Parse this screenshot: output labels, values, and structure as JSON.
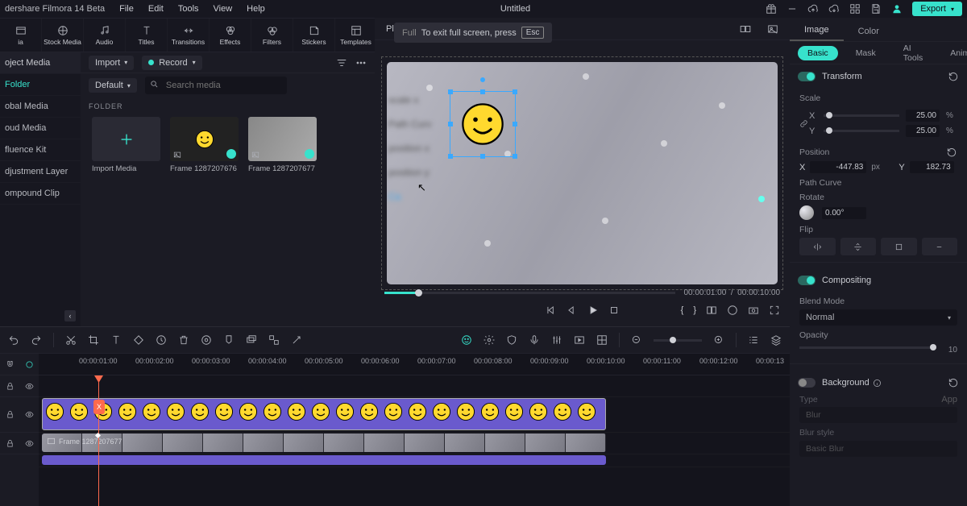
{
  "app_name": "dershare Filmora 14 Beta",
  "menus": [
    "File",
    "Edit",
    "Tools",
    "View",
    "Help"
  ],
  "doc_title": "Untitled",
  "export_label": "Export",
  "ribbon": [
    {
      "id": "media",
      "label": "ia"
    },
    {
      "id": "stock",
      "label": "Stock Media"
    },
    {
      "id": "audio",
      "label": "Audio"
    },
    {
      "id": "titles",
      "label": "Titles"
    },
    {
      "id": "trans",
      "label": "Transitions"
    },
    {
      "id": "effects",
      "label": "Effects"
    },
    {
      "id": "filters",
      "label": "Filters"
    },
    {
      "id": "stickers",
      "label": "Stickers"
    },
    {
      "id": "templates",
      "label": "Templates"
    }
  ],
  "sidebar": {
    "header": "oject Media",
    "items": [
      "Folder",
      "obal Media",
      "oud Media",
      "fluence Kit",
      "djustment Layer",
      "ompound Clip"
    ]
  },
  "browser": {
    "import": "Import",
    "record": "Record",
    "default": "Default",
    "search_placeholder": "Search media",
    "folder_label": "FOLDER",
    "thumbs": [
      {
        "label": "Import Media"
      },
      {
        "label": "Frame 1287207676"
      },
      {
        "label": "Frame 1287207677"
      }
    ]
  },
  "player": {
    "tab": "Player",
    "overlay_text": "To exit full screen, press",
    "overlay_key": "Esc",
    "time_current": "00:00:01:00",
    "time_sep": "/",
    "time_total": "00:00:10:00"
  },
  "inspector": {
    "tabs1": [
      "Image",
      "Color"
    ],
    "tabs2": [
      "Basic",
      "Mask",
      "AI Tools",
      "Animation"
    ],
    "transform": "Transform",
    "scale_label": "Scale",
    "scale_x": "25.00",
    "scale_y": "25.00",
    "pct": "%",
    "position_label": "Position",
    "pos_x": "-447.83",
    "pos_y": "182.73",
    "px": "px",
    "path_curve": "Path Curve",
    "rotate_label": "Rotate",
    "rotate_val": "0.00°",
    "flip_label": "Flip",
    "compositing": "Compositing",
    "blend_label": "Blend Mode",
    "blend_val": "Normal",
    "opacity_label": "Opacity",
    "opacity_val": "10",
    "background": "Background",
    "bg_type_label": "Type",
    "bg_type_val": "Blur",
    "bg_apply": "App",
    "bg_style_label": "Blur style",
    "bg_style_val": "Basic Blur"
  },
  "timeline": {
    "ticks": [
      "00:00:01:00",
      "00:00:02:00",
      "00:00:03:00",
      "00:00:04:00",
      "00:00:05:00",
      "00:00:06:00",
      "00:00:07:00",
      "00:00:08:00",
      "00:00:09:00",
      "00:00:10:00",
      "00:00:11:00",
      "00:00:12:00",
      "00:00:13"
    ],
    "marker": "X",
    "vid_label": "Frame 1287207677"
  }
}
